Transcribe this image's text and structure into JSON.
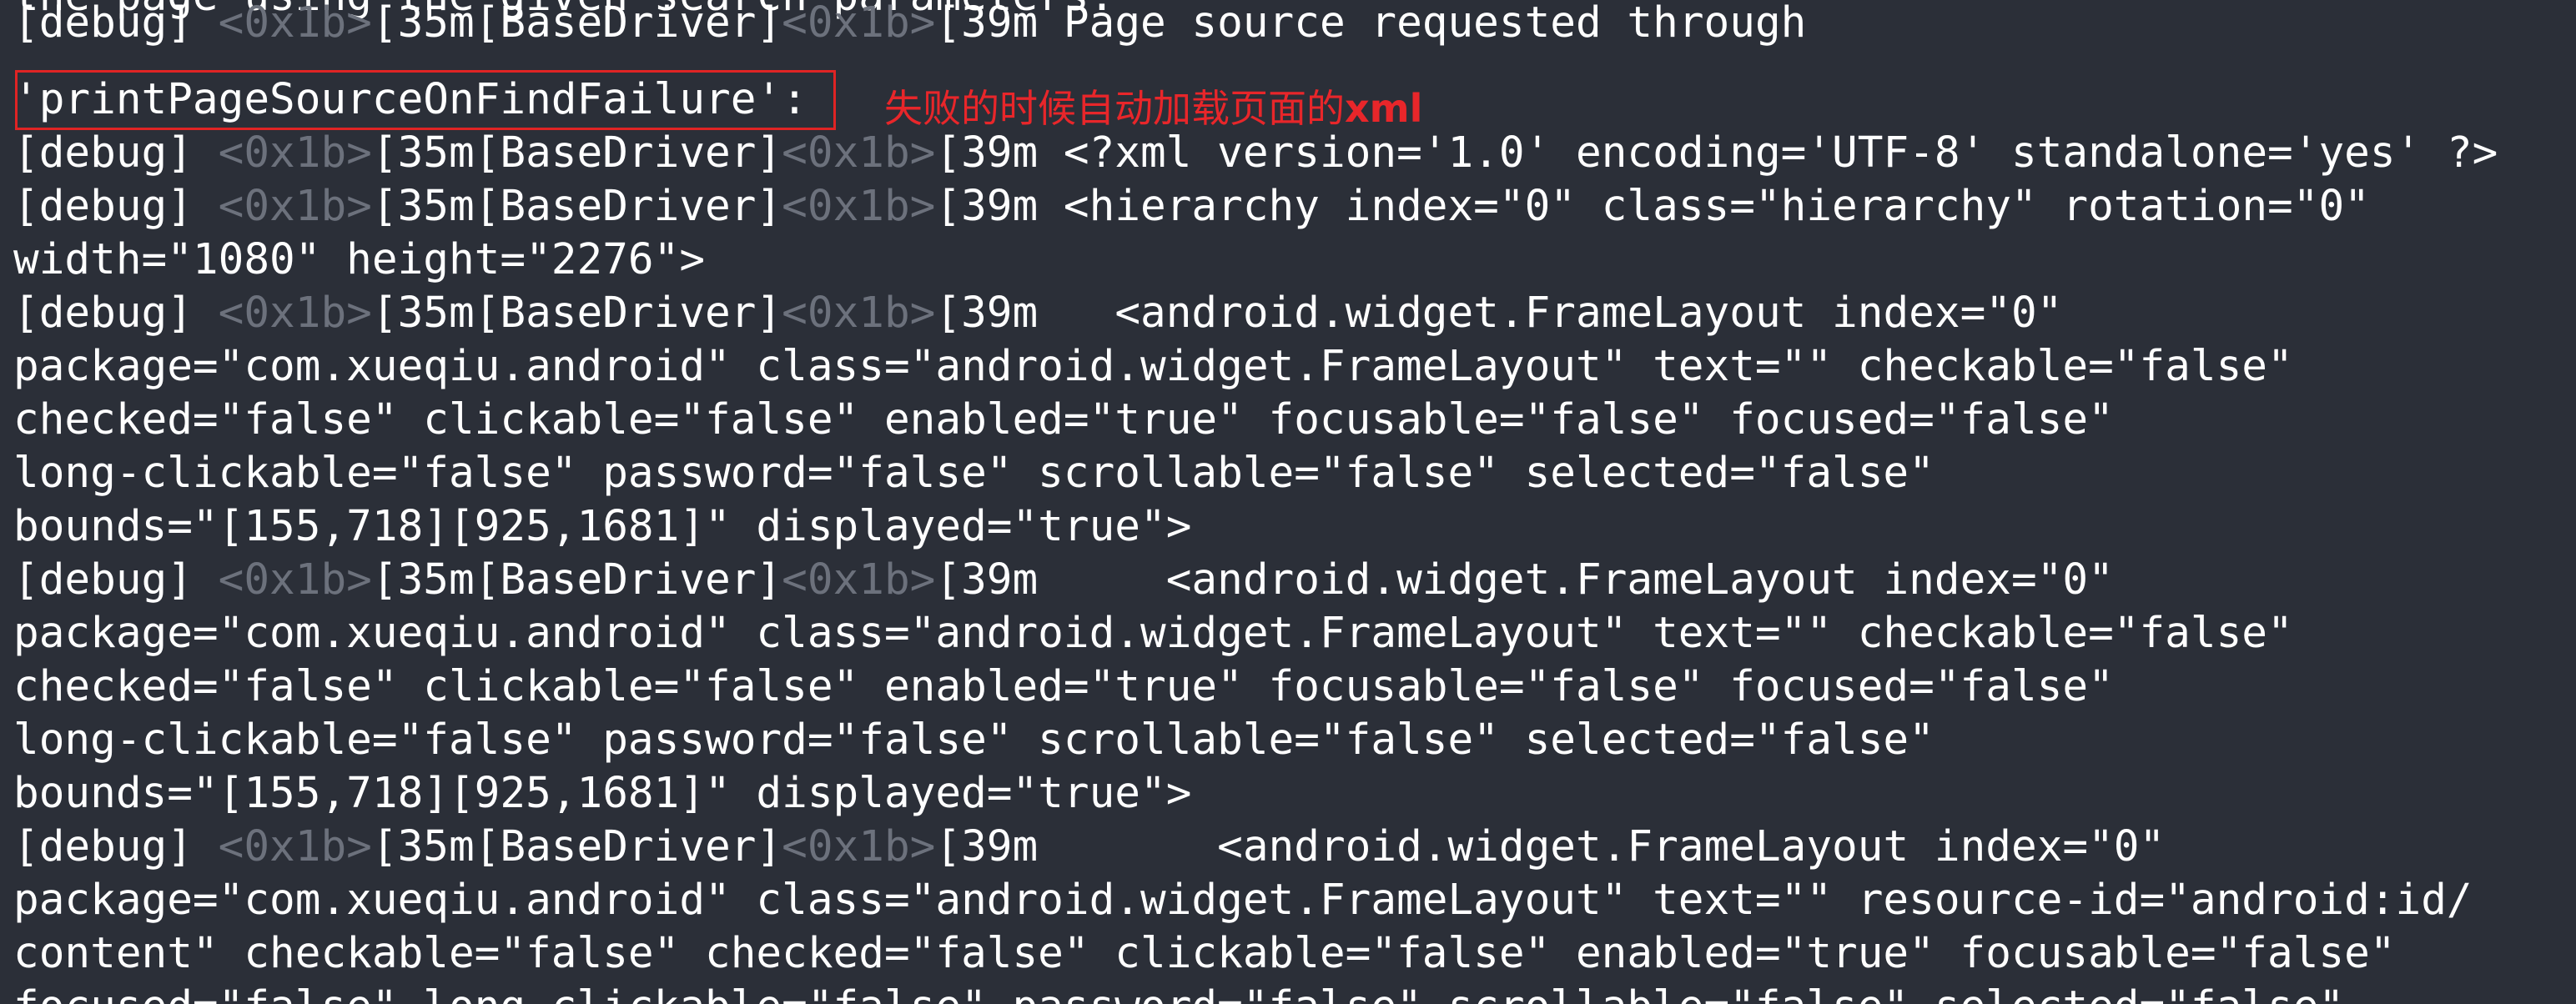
{
  "terminal": {
    "background": "#2b2f38",
    "text_color": "#ffffff",
    "escape_color": "#6c717c",
    "lines": [
      {
        "text": "the page using the given search parameters."
      },
      {
        "prefix": "[debug] ",
        "esc1": "<0x1b>",
        "mid": "[35m[BaseDriver]",
        "esc2": "<0x1b>",
        "text": "[39m Page source requested through"
      },
      {
        "text": "'printPageSourceOnFindFailure':"
      },
      {
        "prefix": "[debug] ",
        "esc1": "<0x1b>",
        "mid": "[35m[BaseDriver]",
        "esc2": "<0x1b>",
        "text": "[39m <?xml version='1.0' encoding='UTF-8' standalone='yes' ?>"
      },
      {
        "prefix": "[debug] ",
        "esc1": "<0x1b>",
        "mid": "[35m[BaseDriver]",
        "esc2": "<0x1b>",
        "text": "[39m <hierarchy index=\"0\" class=\"hierarchy\" rotation=\"0\""
      },
      {
        "text": "width=\"1080\" height=\"2276\">"
      },
      {
        "prefix": "[debug] ",
        "esc1": "<0x1b>",
        "mid": "[35m[BaseDriver]",
        "esc2": "<0x1b>",
        "text": "[39m   <android.widget.FrameLayout index=\"0\""
      },
      {
        "text": "package=\"com.xueqiu.android\" class=\"android.widget.FrameLayout\" text=\"\" checkable=\"false\""
      },
      {
        "text": "checked=\"false\" clickable=\"false\" enabled=\"true\" focusable=\"false\" focused=\"false\""
      },
      {
        "text": "long-clickable=\"false\" password=\"false\" scrollable=\"false\" selected=\"false\""
      },
      {
        "text": "bounds=\"[155,718][925,1681]\" displayed=\"true\">"
      },
      {
        "prefix": "[debug] ",
        "esc1": "<0x1b>",
        "mid": "[35m[BaseDriver]",
        "esc2": "<0x1b>",
        "text": "[39m     <android.widget.FrameLayout index=\"0\""
      },
      {
        "text": "package=\"com.xueqiu.android\" class=\"android.widget.FrameLayout\" text=\"\" checkable=\"false\""
      },
      {
        "text": "checked=\"false\" clickable=\"false\" enabled=\"true\" focusable=\"false\" focused=\"false\""
      },
      {
        "text": "long-clickable=\"false\" password=\"false\" scrollable=\"false\" selected=\"false\""
      },
      {
        "text": "bounds=\"[155,718][925,1681]\" displayed=\"true\">"
      },
      {
        "prefix": "[debug] ",
        "esc1": "<0x1b>",
        "mid": "[35m[BaseDriver]",
        "esc2": "<0x1b>",
        "text": "[39m       <android.widget.FrameLayout index=\"0\""
      },
      {
        "text": "package=\"com.xueqiu.android\" class=\"android.widget.FrameLayout\" text=\"\" resource-id=\"android:id/"
      },
      {
        "text": "content\" checkable=\"false\" checked=\"false\" clickable=\"false\" enabled=\"true\" focusable=\"false\""
      },
      {
        "text": "focused=\"false\" long-clickable=\"false\" password=\"false\" scrollable=\"false\" selected=\"false\""
      }
    ]
  },
  "annotation": {
    "text": "失败的时候自动加载页面的",
    "bold_text": "xml",
    "color": "#e8262a"
  },
  "highlight": {
    "color": "#e02424"
  }
}
